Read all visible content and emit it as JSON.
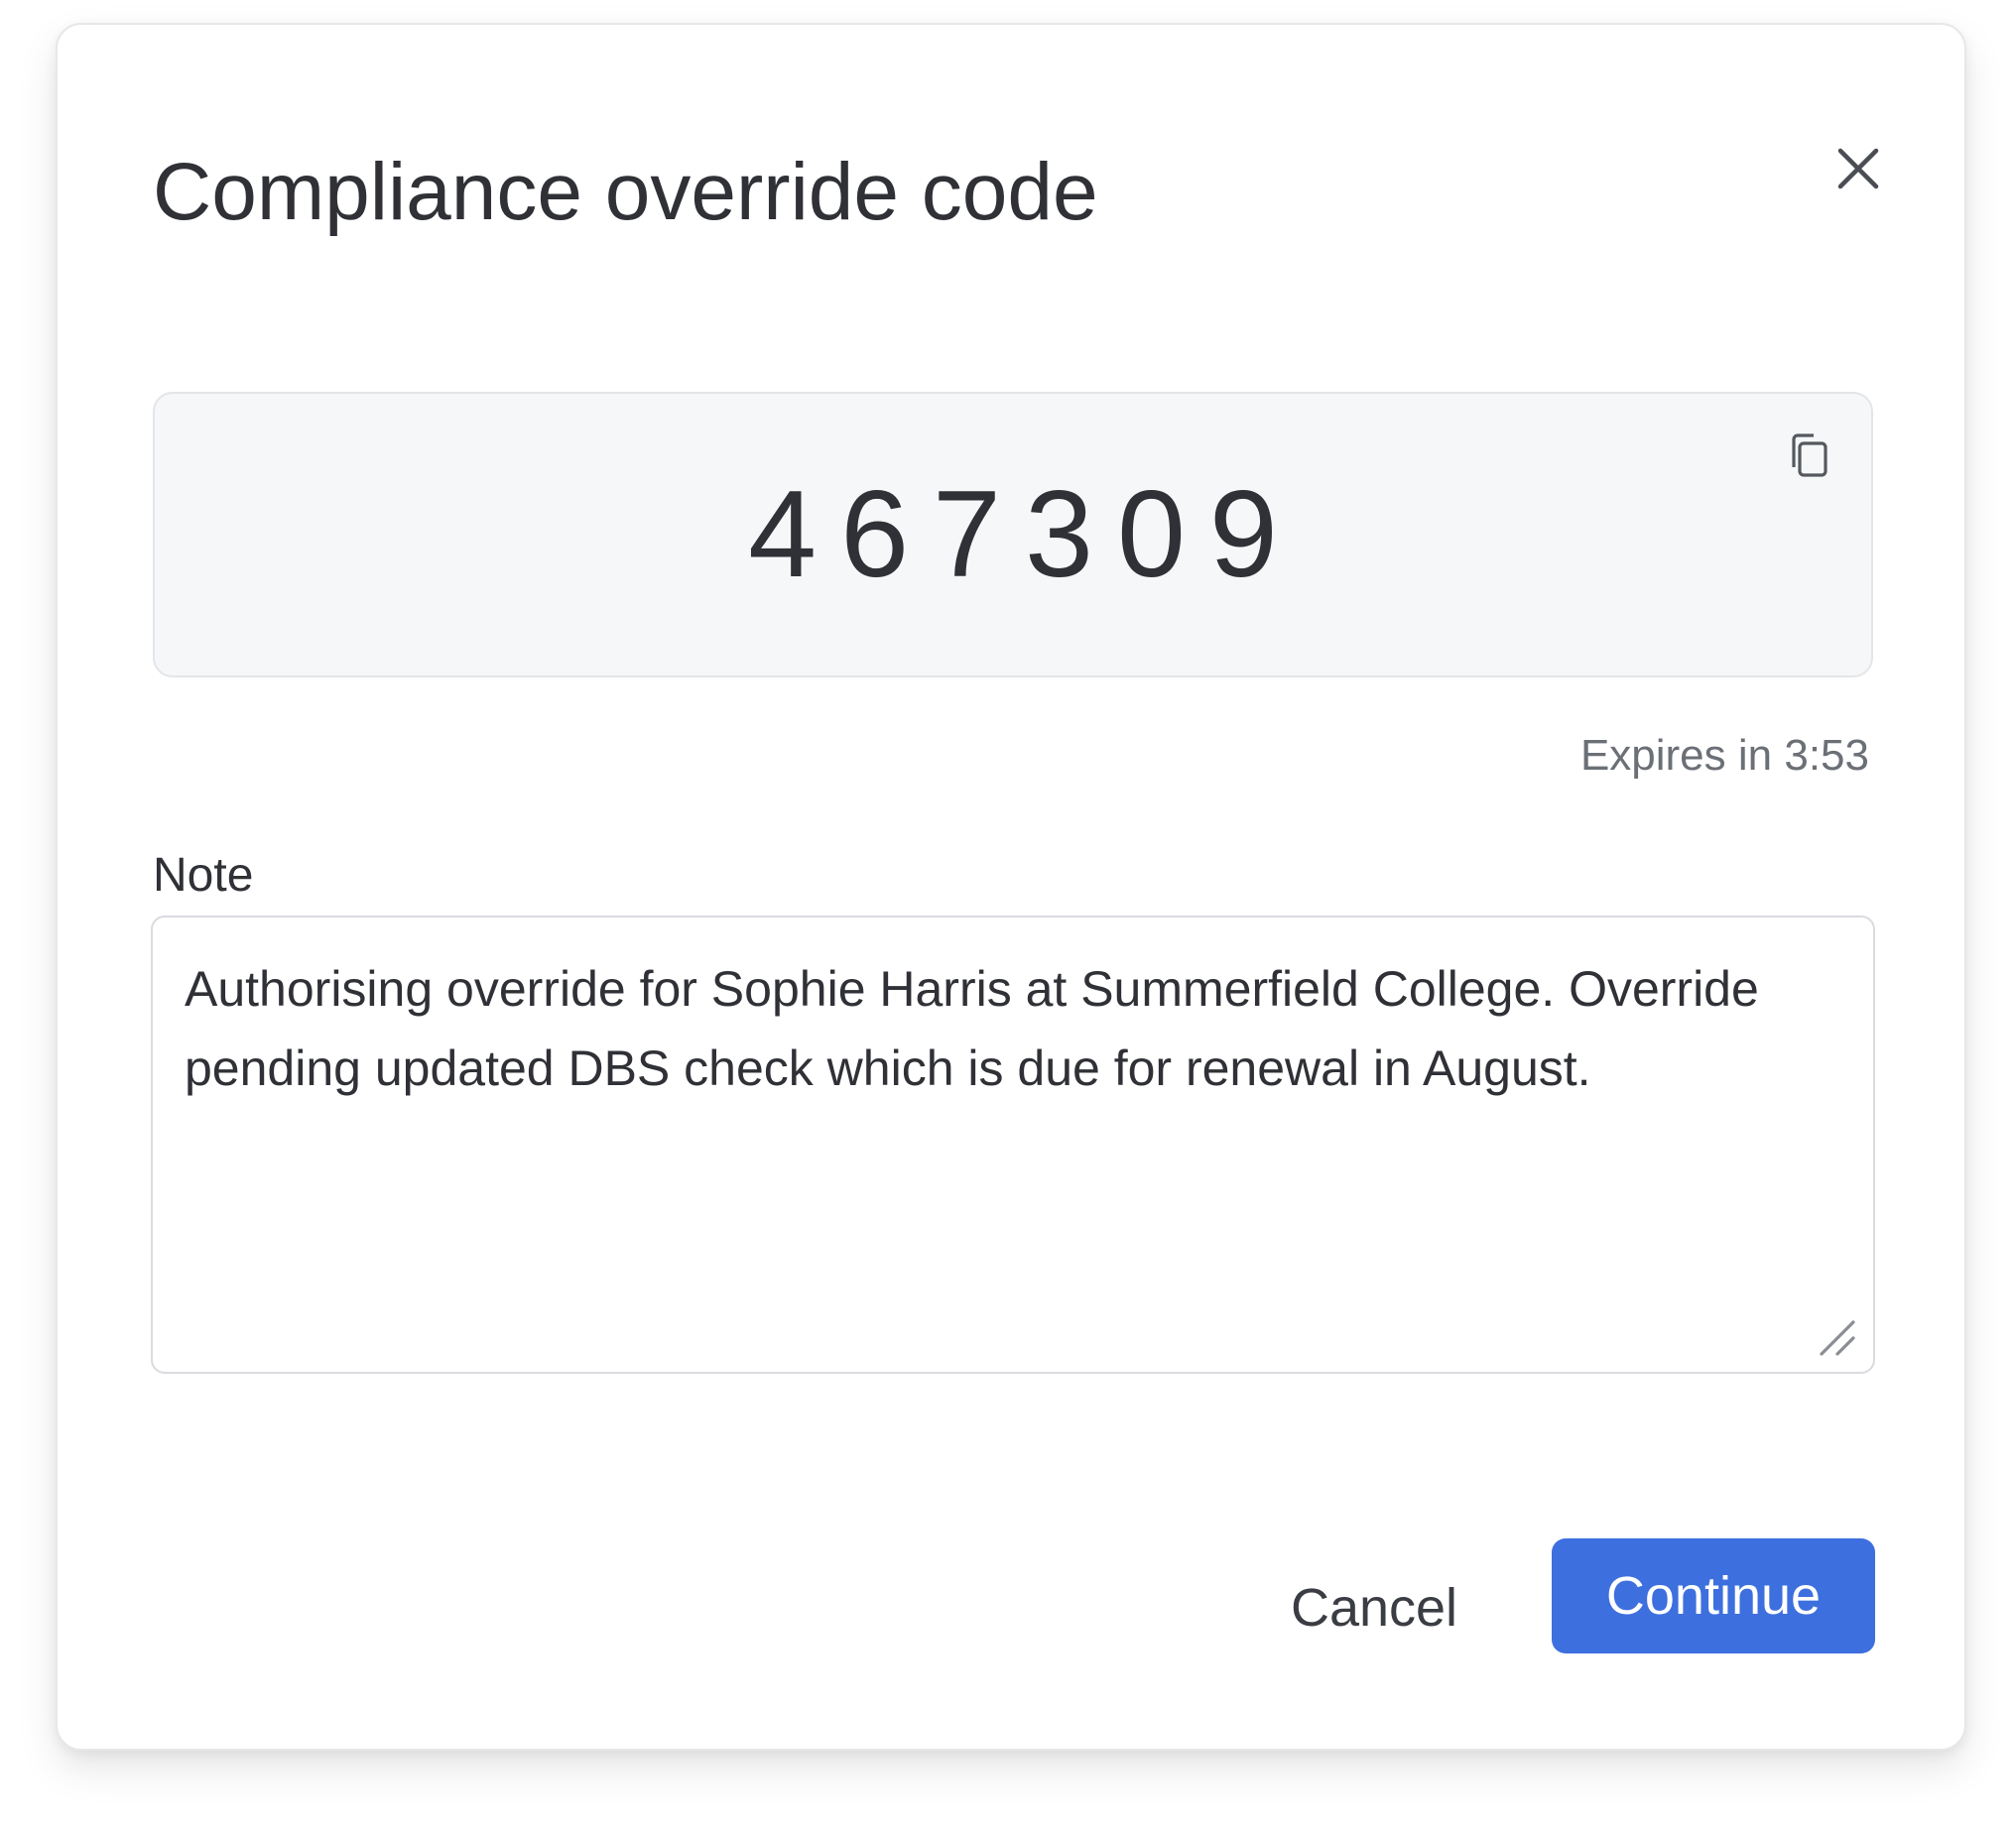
{
  "dialog": {
    "title": "Compliance override code",
    "close_icon": "close-icon"
  },
  "code": {
    "value": "467309",
    "copy_icon": "copy-icon",
    "expires_text": "Expires in 3:53"
  },
  "note": {
    "label": "Note",
    "value": "Authorising override for Sophie Harris at Summerfield College. Override pending updated DBS check which is due for renewal in August."
  },
  "actions": {
    "cancel_label": "Cancel",
    "continue_label": "Continue"
  },
  "colors": {
    "primary": "#3d6fde",
    "code_background": "#f6f7f9",
    "text": "#2f3136",
    "muted_text": "#6b6f76"
  }
}
